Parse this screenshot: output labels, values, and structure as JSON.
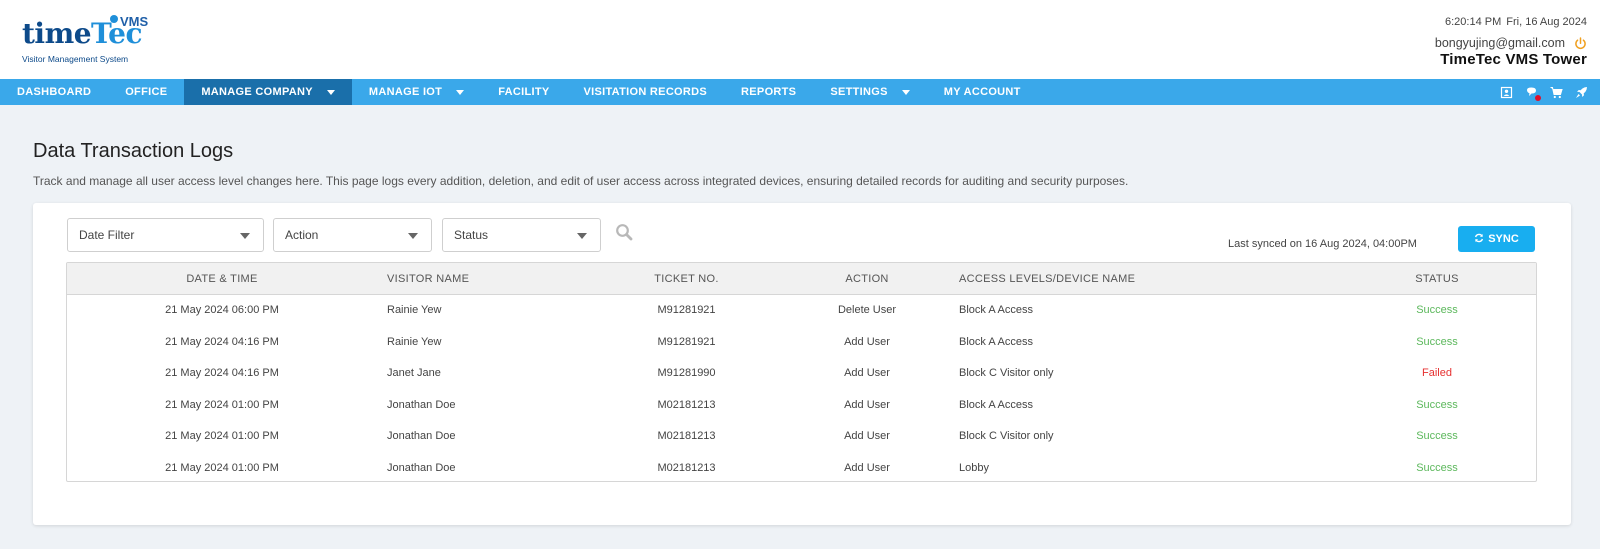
{
  "brand": {
    "logo_word_prefix": "time",
    "logo_word_suffix": "Tec",
    "logo_superscript": "VMS",
    "logo_subtitle": "Visitor Management System",
    "primary_color": "#0d4a8a",
    "accent_color": "#1f8fd9"
  },
  "header": {
    "time": "6:20:14 PM",
    "date": "Fri, 16 Aug 2024",
    "user_email": "bongyujing@gmail.com",
    "power_icon": "power-icon",
    "building_name": "TimeTec VMS Tower"
  },
  "nav": {
    "items": [
      {
        "label": "DASHBOARD",
        "dropdown": false
      },
      {
        "label": "OFFICE",
        "dropdown": false
      },
      {
        "label": "MANAGE COMPANY",
        "dropdown": true,
        "active": true
      },
      {
        "label": "MANAGE IOT",
        "dropdown": true
      },
      {
        "label": "FACILITY",
        "dropdown": false
      },
      {
        "label": "VISITATION RECORDS",
        "dropdown": false
      },
      {
        "label": "REPORTS",
        "dropdown": false
      },
      {
        "label": "SETTINGS",
        "dropdown": true
      },
      {
        "label": "MY ACCOUNT",
        "dropdown": false
      }
    ],
    "icons": [
      "contact-card-icon",
      "chat-notification-icon",
      "cart-icon",
      "rocket-icon"
    ],
    "bar_color": "#3aa8ea",
    "active_color": "#1a6faa"
  },
  "page": {
    "title": "Data Transaction Logs",
    "description": "Track and manage all user access level changes here. This page logs every addition, deletion, and edit of user access across integrated devices, ensuring detailed records for auditing and security purposes."
  },
  "filters": {
    "date": "Date Filter",
    "action": "Action",
    "status": "Status",
    "search_icon": "search-icon"
  },
  "sync": {
    "last_synced": "Last synced on 16 Aug 2024, 04:00PM",
    "button_label": "SYNC",
    "button_color": "#18aef0"
  },
  "table": {
    "columns": [
      "DATE & TIME",
      "VISITOR NAME",
      "TICKET NO.",
      "ACTION",
      "ACCESS LEVELS/DEVICE NAME",
      "STATUS"
    ],
    "rows": [
      {
        "date": "21 May 2024 06:00 PM",
        "name": "Rainie Yew",
        "ticket": "M91281921",
        "action": "Delete User",
        "access": "Block A Access",
        "status": "Success"
      },
      {
        "date": "21 May 2024 04:16 PM",
        "name": "Rainie Yew",
        "ticket": "M91281921",
        "action": "Add User",
        "access": "Block A Access",
        "status": "Success"
      },
      {
        "date": "21 May 2024 04:16 PM",
        "name": "Janet Jane",
        "ticket": "M91281990",
        "action": "Add User",
        "access": "Block C Visitor only",
        "status": "Failed"
      },
      {
        "date": "21 May 2024 01:00 PM",
        "name": "Jonathan Doe",
        "ticket": "M02181213",
        "action": "Add User",
        "access": "Block A Access",
        "status": "Success"
      },
      {
        "date": "21 May 2024 01:00 PM",
        "name": "Jonathan Doe",
        "ticket": "M02181213",
        "action": "Add User",
        "access": "Block C Visitor only",
        "status": "Success"
      },
      {
        "date": "21 May 2024 01:00 PM",
        "name": "Jonathan Doe",
        "ticket": "M02181213",
        "action": "Add User",
        "access": "Lobby",
        "status": "Success"
      }
    ],
    "status_colors": {
      "Success": "#5cb85c",
      "Failed": "#e63030"
    }
  }
}
